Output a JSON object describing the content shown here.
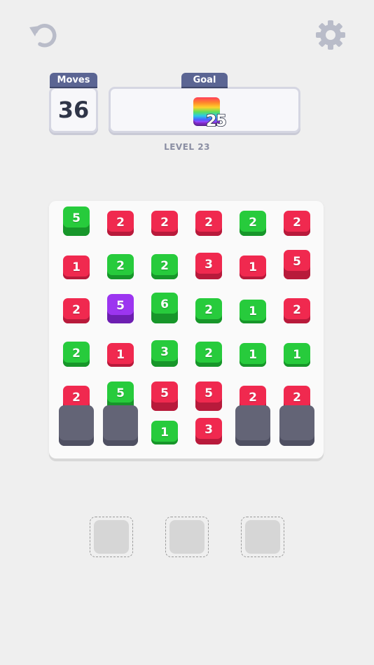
{
  "hud": {
    "moves_label": "Moves",
    "moves_value": "36",
    "goal_label": "Goal",
    "goal_count": "25",
    "level_text": "LEVEL 23"
  },
  "icons": {
    "undo": "undo-icon",
    "settings": "gear-icon"
  },
  "colors": {
    "red": "#f0294f",
    "green": "#27cb3c",
    "purple": "#9c35f0",
    "tag": "#5b6593",
    "empty_slot": "#636476"
  },
  "board": {
    "rows": [
      [
        {
          "color": "green",
          "value": "5",
          "stack": 5
        },
        {
          "color": "red",
          "value": "2",
          "stack": 2
        },
        {
          "color": "red",
          "value": "2",
          "stack": 2
        },
        {
          "color": "red",
          "value": "2",
          "stack": 2
        },
        {
          "color": "green",
          "value": "2",
          "stack": 2
        },
        {
          "color": "red",
          "value": "2",
          "stack": 2
        }
      ],
      [
        {
          "color": "red",
          "value": "1",
          "stack": 1
        },
        {
          "color": "green",
          "value": "2",
          "stack": 2
        },
        {
          "color": "green",
          "value": "2",
          "stack": 2
        },
        {
          "color": "red",
          "value": "3",
          "stack": 3
        },
        {
          "color": "red",
          "value": "1",
          "stack": 1
        },
        {
          "color": "red",
          "value": "5",
          "stack": 5
        }
      ],
      [
        {
          "color": "red",
          "value": "2",
          "stack": 2
        },
        {
          "color": "purple",
          "value": "5",
          "stack": 5
        },
        {
          "color": "green",
          "value": "6",
          "stack": 6
        },
        {
          "color": "green",
          "value": "2",
          "stack": 2
        },
        {
          "color": "green",
          "value": "1",
          "stack": 1
        },
        {
          "color": "red",
          "value": "2",
          "stack": 2
        }
      ],
      [
        {
          "color": "green",
          "value": "2",
          "stack": 2
        },
        {
          "color": "red",
          "value": "1",
          "stack": 1
        },
        {
          "color": "green",
          "value": "3",
          "stack": 3
        },
        {
          "color": "green",
          "value": "2",
          "stack": 2
        },
        {
          "color": "green",
          "value": "1",
          "stack": 1
        },
        {
          "color": "green",
          "value": "1",
          "stack": 1
        }
      ],
      [
        {
          "color": "red",
          "value": "2",
          "stack": 2
        },
        {
          "color": "green",
          "value": "5",
          "stack": 5
        },
        {
          "color": "red",
          "value": "5",
          "stack": 5
        },
        {
          "color": "red",
          "value": "5",
          "stack": 5
        },
        {
          "color": "red",
          "value": "2",
          "stack": 2
        },
        {
          "color": "red",
          "value": "2",
          "stack": 2
        }
      ],
      [
        {
          "empty": true
        },
        {
          "empty": true
        },
        {
          "color": "green",
          "value": "1",
          "stack": 1
        },
        {
          "color": "red",
          "value": "3",
          "stack": 3
        },
        {
          "empty": true
        },
        {
          "empty": true
        }
      ]
    ]
  },
  "tray_slots": 3
}
